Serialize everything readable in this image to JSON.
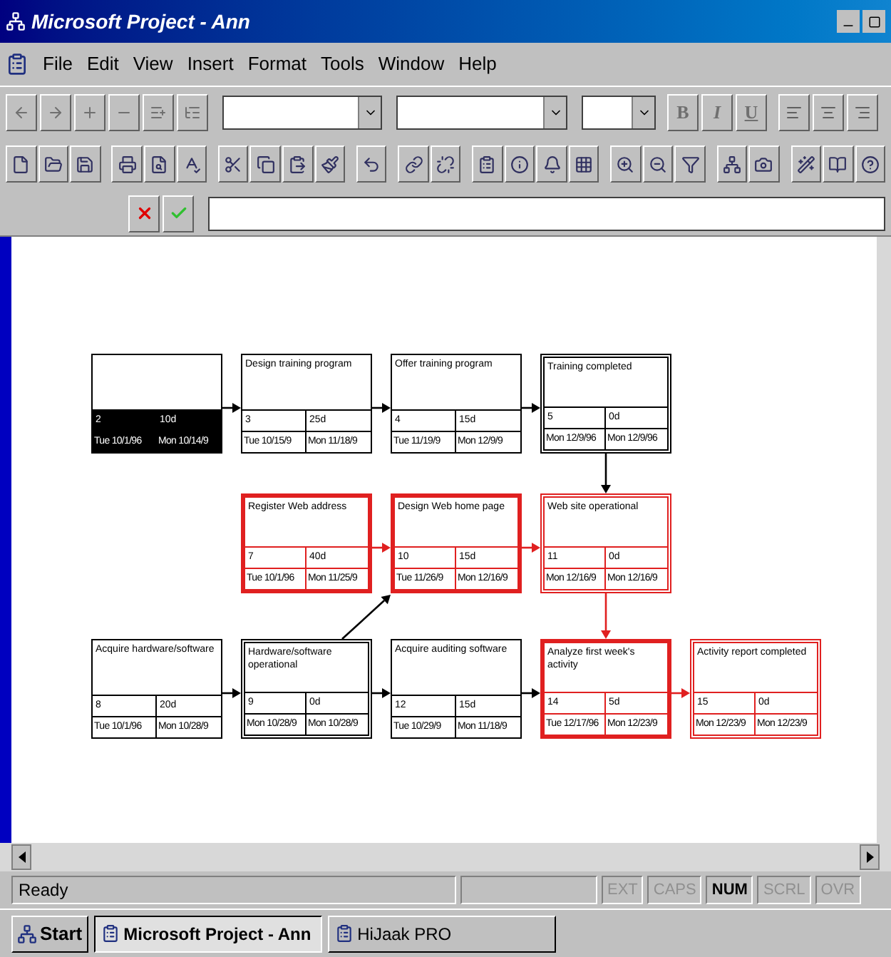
{
  "window": {
    "title": "Microsoft Project - Ann"
  },
  "menu": [
    "File",
    "Edit",
    "View",
    "Insert",
    "Format",
    "Tools",
    "Window",
    "Help"
  ],
  "format_buttons": [
    "B",
    "I",
    "U"
  ],
  "rows": [
    [
      {
        "id": "2",
        "duration": "10d",
        "start": "Tue 10/1/96",
        "finish": "Mon 10/14/9",
        "critical": false,
        "milestone": false,
        "selected": true
      },
      {
        "title": "Design training program",
        "id": "3",
        "duration": "25d",
        "start": "Tue 10/15/9",
        "finish": "Mon 11/18/9",
        "critical": false,
        "milestone": false,
        "selected": false
      },
      {
        "title": "Offer training program",
        "id": "4",
        "duration": "15d",
        "start": "Tue 11/19/9",
        "finish": "Mon 12/9/9",
        "critical": false,
        "milestone": false,
        "selected": false
      },
      {
        "title": "Training completed",
        "id": "5",
        "duration": "0d",
        "start": "Mon 12/9/96",
        "finish": "Mon 12/9/96",
        "critical": false,
        "milestone": true,
        "selected": false
      }
    ],
    [
      {
        "title": "Register Web address",
        "id": "7",
        "duration": "40d",
        "start": "Tue 10/1/96",
        "finish": "Mon 11/25/9",
        "critical": true,
        "milestone": false,
        "selected": false
      },
      {
        "title": "Design Web home page",
        "id": "10",
        "duration": "15d",
        "start": "Tue 11/26/9",
        "finish": "Mon 12/16/9",
        "critical": true,
        "milestone": false,
        "selected": false
      },
      {
        "title": "Web site operational",
        "id": "11",
        "duration": "0d",
        "start": "Mon 12/16/9",
        "finish": "Mon 12/16/9",
        "critical": true,
        "milestone": true,
        "selected": false
      }
    ],
    [
      {
        "title": "Acquire hardware/software",
        "id": "8",
        "duration": "20d",
        "start": "Tue 10/1/96",
        "finish": "Mon 10/28/9",
        "critical": false,
        "milestone": false,
        "selected": false
      },
      {
        "title": "Hardware/software operational",
        "id": "9",
        "duration": "0d",
        "start": "Mon 10/28/9",
        "finish": "Mon 10/28/9",
        "critical": false,
        "milestone": true,
        "selected": false
      },
      {
        "title": "Acquire auditing software",
        "id": "12",
        "duration": "15d",
        "start": "Tue 10/29/9",
        "finish": "Mon 11/18/9",
        "critical": false,
        "milestone": false,
        "selected": false
      },
      {
        "title": "Analyze first week's activity",
        "id": "14",
        "duration": "5d",
        "start": "Tue 12/17/96",
        "finish": "Mon 12/23/9",
        "critical": true,
        "milestone": false,
        "selected": false
      },
      {
        "title": "Activity report completed",
        "id": "15",
        "duration": "0d",
        "start": "Mon 12/23/9",
        "finish": "Mon 12/23/9",
        "critical": true,
        "milestone": true,
        "selected": false
      }
    ]
  ],
  "status_bar": {
    "text": "Ready",
    "indicators": [
      {
        "label": "EXT",
        "on": false
      },
      {
        "label": "CAPS",
        "on": false
      },
      {
        "label": "NUM",
        "on": true
      },
      {
        "label": "SCRL",
        "on": false
      },
      {
        "label": "OVR",
        "on": false
      }
    ]
  },
  "taskbar": {
    "start": "Start",
    "tasks": [
      {
        "label": "Microsoft Project - Ann",
        "selected": true
      },
      {
        "label": "HiJaak PRO",
        "selected": false
      }
    ]
  }
}
